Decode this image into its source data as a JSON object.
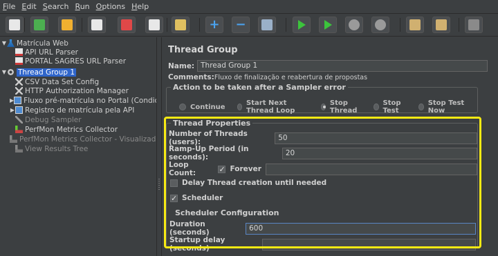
{
  "menu": [
    {
      "u": "F",
      "rest": "ile"
    },
    {
      "u": "E",
      "rest": "dit"
    },
    {
      "u": "S",
      "rest": "earch"
    },
    {
      "u": "R",
      "rest": "un"
    },
    {
      "u": "O",
      "rest": "ptions"
    },
    {
      "u": "H",
      "rest": "elp"
    }
  ],
  "toolbar": [
    {
      "name": "new-button",
      "icon": "new-icon",
      "color": "#e8e8e8"
    },
    {
      "name": "templates-button",
      "icon": "templates-icon",
      "color": "#4caf50"
    },
    {
      "name": "open-button",
      "icon": "open-folder-icon",
      "color": "#f0b030"
    },
    {
      "name": "save-button",
      "icon": "save-icon",
      "color": "#e8e8e8"
    },
    {
      "name": "cut-button",
      "icon": "cut-icon",
      "color": "#e04848"
    },
    {
      "name": "copy-button",
      "icon": "copy-icon",
      "color": "#e8e8e8"
    },
    {
      "name": "paste-button",
      "icon": "paste-icon",
      "color": "#e0c060"
    },
    {
      "name": "expand-button",
      "icon": "plus-icon",
      "color": "#4aa3f0"
    },
    {
      "name": "collapse-button",
      "icon": "minus-icon",
      "color": "#4aa3f0"
    },
    {
      "name": "toggle-button",
      "icon": "toggle-icon",
      "color": "#9ab0c8"
    },
    {
      "name": "start-button",
      "icon": "play-icon",
      "color": "#3cc43c"
    },
    {
      "name": "start-no-pauses-button",
      "icon": "play-no-pause-icon",
      "color": "#3cc43c"
    },
    {
      "name": "stop-button",
      "icon": "stop-icon",
      "color": "#9a9a9a"
    },
    {
      "name": "shutdown-button",
      "icon": "shutdown-icon",
      "color": "#9a9a9a"
    },
    {
      "name": "clear-button",
      "icon": "broom-icon",
      "color": "#d0b070"
    },
    {
      "name": "clear-all-button",
      "icon": "broom-all-icon",
      "color": "#d0b070"
    },
    {
      "name": "search-button",
      "icon": "binoculars-icon",
      "color": "#8a8a8a"
    }
  ],
  "tree": [
    {
      "label": "Matrícula Web",
      "icon": "test-plan-icon",
      "caret": "▼",
      "indent": 0,
      "selected": false,
      "disabled": false
    },
    {
      "label": "API URL Parser",
      "icon": "sampler-icon",
      "caret": "",
      "indent": 1,
      "selected": false,
      "disabled": false
    },
    {
      "label": "PORTAL SAGRES URL Parser",
      "icon": "sampler-icon",
      "caret": "",
      "indent": 1,
      "selected": false,
      "disabled": false
    },
    {
      "label": "Thread Group 1",
      "icon": "gear-icon",
      "caret": "▼",
      "indent": 0,
      "selected": true,
      "disabled": false
    },
    {
      "label": "CSV Data Set Config",
      "icon": "config-icon",
      "caret": "",
      "indent": 1,
      "selected": false,
      "disabled": false
    },
    {
      "label": "HTTP Authorization Manager",
      "icon": "config-icon",
      "caret": "",
      "indent": 1,
      "selected": false,
      "disabled": false
    },
    {
      "label": "Fluxo pré-matrícula no Portal (Condiciona",
      "icon": "controller-icon",
      "caret": "▶",
      "indent": 1,
      "selected": false,
      "disabled": false
    },
    {
      "label": "Registro de matrícula pela API",
      "icon": "controller-icon",
      "caret": "▶",
      "indent": 1,
      "selected": false,
      "disabled": false
    },
    {
      "label": "Debug Sampler",
      "icon": "debug-icon",
      "caret": "",
      "indent": 1,
      "selected": false,
      "disabled": true
    },
    {
      "label": "PerfMon Metrics Collector",
      "icon": "chart-icon",
      "caret": "",
      "indent": 1,
      "selected": false,
      "disabled": false
    },
    {
      "label": "PerfMon Metrics Collector - Visualizador",
      "icon": "chart-icon",
      "caret": "",
      "indent": 1,
      "selected": false,
      "disabled": true
    },
    {
      "label": "View Results Tree",
      "icon": "chart-icon",
      "caret": "",
      "indent": 1,
      "selected": false,
      "disabled": true
    }
  ],
  "panel": {
    "title": "Thread Group",
    "name_label": "Name:",
    "name_value": "Thread Group 1",
    "comments_label": "Comments:",
    "comments_value": "Fluxo de finalização e reabertura de propostas",
    "error_action_legend": "Action to be taken after a Sampler error",
    "error_actions": [
      {
        "label": "Continue",
        "selected": false
      },
      {
        "label": "Start Next Thread Loop",
        "selected": false
      },
      {
        "label": "Stop Thread",
        "selected": true
      },
      {
        "label": "Stop Test",
        "selected": false
      },
      {
        "label": "Stop Test Now",
        "selected": false
      }
    ],
    "thread_props_legend": "Thread Properties",
    "threads_label": "Number of Threads (users):",
    "threads_value": "50",
    "rampup_label": "Ramp-Up Period (in seconds):",
    "rampup_value": "20",
    "loop_label": "Loop Count:",
    "forever_label": "Forever",
    "forever_checked": true,
    "loop_value": "",
    "delay_label": "Delay Thread creation until needed",
    "delay_checked": false,
    "scheduler_label": "Scheduler",
    "scheduler_checked": true,
    "scheduler_legend": "Scheduler Configuration",
    "duration_label": "Duration (seconds)",
    "duration_value": "600",
    "startup_label": "Startup delay (seconds)",
    "startup_value": ""
  },
  "colors": {
    "highlight": "#f7ea13",
    "selection": "#2f65ca",
    "background": "#3c3f41"
  }
}
